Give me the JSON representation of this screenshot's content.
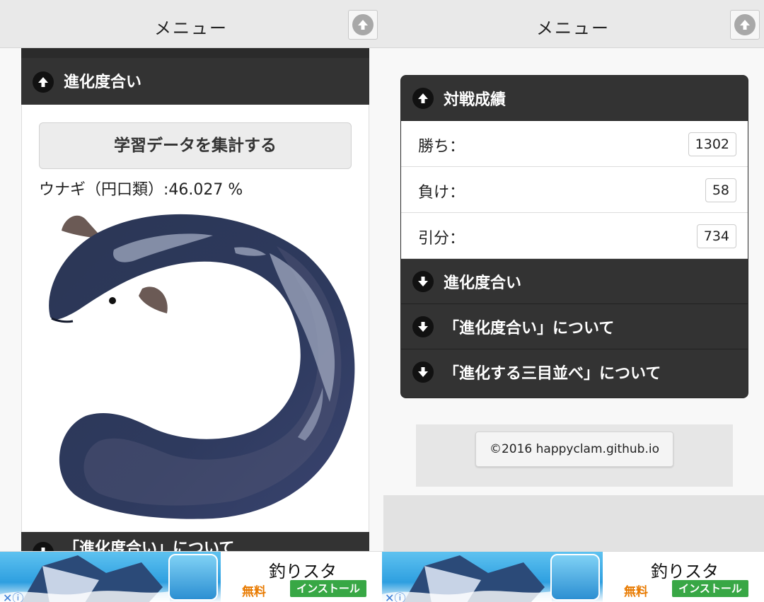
{
  "left": {
    "topbar": {
      "title": "メニュー"
    },
    "section": {
      "title": "進化度合い"
    },
    "aggregate_button": "学習データを集計する",
    "result": "ウナギ（円口類）:46.027 %",
    "next_section": "「進化度合い」について"
  },
  "right": {
    "topbar": {
      "title": "メニュー"
    },
    "stats": {
      "title": "対戦成績",
      "rows": [
        {
          "label": "勝ち：",
          "value": "1302"
        },
        {
          "label": "負け：",
          "value": "58"
        },
        {
          "label": "引分：",
          "value": "734"
        }
      ]
    },
    "accordions": [
      {
        "label": "進化度合い"
      },
      {
        "label": "「進化度合い」について"
      },
      {
        "label": "「進化する三目並べ」について"
      }
    ],
    "copyright": "©2016 happyclam.github.io"
  },
  "ad": {
    "title": "釣りスタ",
    "free": "無料",
    "install": "インストール"
  },
  "colors": {
    "header": "#333333",
    "topbar": "#e9e9e9",
    "install": "#38a745",
    "free": "#e87a00"
  },
  "icons": [
    "arrow-up-circle-icon",
    "arrow-down-circle-icon",
    "scroll-top-icon",
    "eel-illustration",
    "adchoices-icon"
  ]
}
